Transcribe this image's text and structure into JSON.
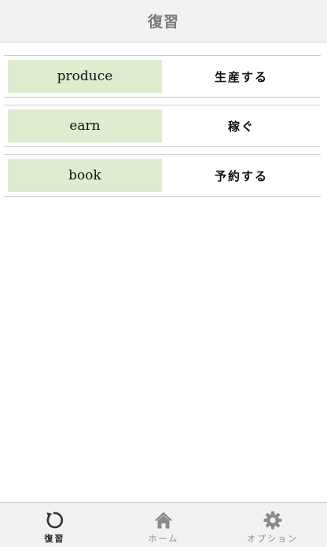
{
  "header": {
    "title": "復習"
  },
  "review_list": [
    {
      "word": "produce",
      "meaning": "生産する"
    },
    {
      "word": "earn",
      "meaning": "稼ぐ"
    },
    {
      "word": "book",
      "meaning": "予約する"
    }
  ],
  "tabbar": {
    "active_color": "#333333",
    "inactive_color": "#8a8a8a",
    "tabs": [
      {
        "label": "復習",
        "icon": "refresh-icon",
        "active": true
      },
      {
        "label": "ホーム",
        "icon": "home-icon",
        "active": false
      },
      {
        "label": "オプション",
        "icon": "gear-icon",
        "active": false
      }
    ]
  },
  "colors": {
    "word_cell_bg": "#deeccf",
    "header_bg": "#f2f2f2"
  }
}
